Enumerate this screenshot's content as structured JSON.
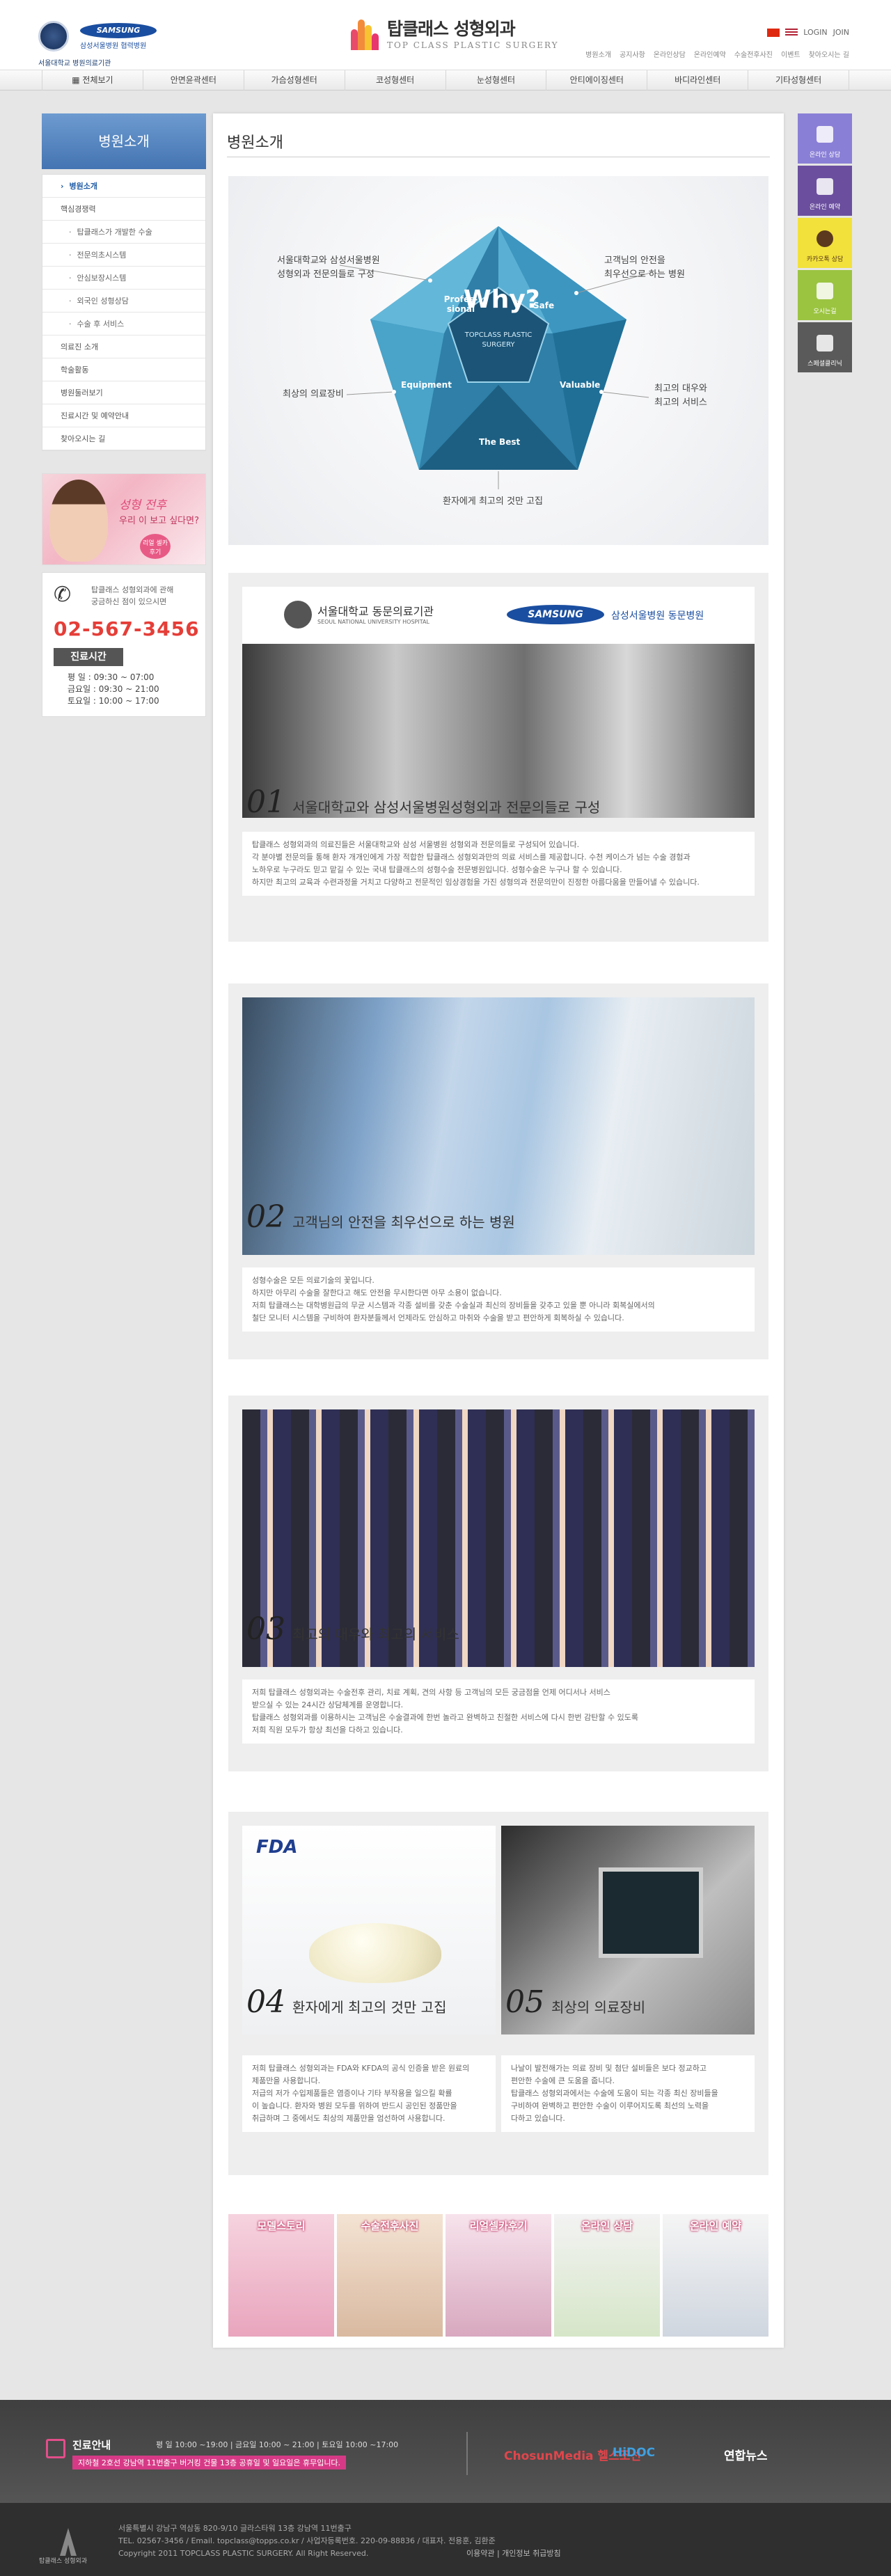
{
  "header": {
    "snu_label": "서울대학교 병원의료기관",
    "samsung_logo": "SAMSUNG",
    "samsung_label": "삼성서울병원 협력병원",
    "brand_title": "탑클래스 성형외과",
    "brand_sub": "TOP CLASS PLASTIC SURGERY",
    "login": "LOGIN",
    "join": "JOIN",
    "util_links": [
      "병원소개",
      "공지사항",
      "온라인상담",
      "온라인예약",
      "수술전후사진",
      "이벤트",
      "찾아오시는 길"
    ]
  },
  "gnb": {
    "items": [
      "전체보기",
      "안면윤곽센터",
      "가슴성형센터",
      "코성형센터",
      "눈성형센터",
      "안티에이징센터",
      "바디라인센터",
      "기타성형센터"
    ]
  },
  "lnb": {
    "title": "병원소개",
    "items": [
      {
        "label": "병원소개",
        "type": "active"
      },
      {
        "label": "핵심경쟁력",
        "type": "main"
      },
      {
        "label": "탑클래스가 개발한 수술",
        "type": "sub"
      },
      {
        "label": "전문의초시스템",
        "type": "sub"
      },
      {
        "label": "안심보장시스템",
        "type": "sub"
      },
      {
        "label": "외국인 성형상담",
        "type": "sub"
      },
      {
        "label": "수술 후 서비스",
        "type": "sub"
      },
      {
        "label": "의료진 소개",
        "type": "main"
      },
      {
        "label": "학술활동",
        "type": "main"
      },
      {
        "label": "병원둘러보기",
        "type": "main"
      },
      {
        "label": "진료시간 및 예약안내",
        "type": "main"
      },
      {
        "label": "찾아오시는 길",
        "type": "main"
      }
    ]
  },
  "promo": {
    "line1": "성형 전후",
    "line2": "우리 이 보고 싶다면?",
    "badge": "리얼 셀카후기"
  },
  "contact": {
    "text1": "탑클래스 성형외과에 관해",
    "text2": "궁금하신 점이 있으시면",
    "phone": "02-567-3456",
    "hours_title": "진료시간",
    "hours": [
      "평   일 : 09:30 ~ 07:00",
      "금요일 : 09:30 ~ 21:00",
      "토요일 : 10:00 ~ 17:00"
    ]
  },
  "quick": {
    "items": [
      {
        "label": "온라인 상담",
        "color": "#8a7fd6"
      },
      {
        "label": "온라인 예약",
        "color": "#6b4f9e"
      },
      {
        "label": "카카오톡 상담",
        "color": "#f2e13a"
      },
      {
        "label": "오시는길",
        "color": "#9bc441"
      },
      {
        "label": "스페셜클리닉",
        "color": "#5a5a5a"
      }
    ]
  },
  "main": {
    "page_title": "병원소개",
    "why": {
      "center": "Why?",
      "center_sub1": "TOPCLASS PLASTIC",
      "center_sub2": "SURGERY",
      "segments": [
        "Profes-sional",
        "Safe",
        "Valuable",
        "The Best",
        "Equipment"
      ],
      "labels": {
        "top_left1": "서울대학교와 삼성서울병원",
        "top_left2": "성형외과 전문의들로 구성",
        "top_right1": "고객님의 안전을",
        "top_right2": "최우선으로 하는 병원",
        "mid_left": "최상의 의료장비",
        "mid_right1": "최고의 대우와",
        "mid_right2": "최고의 서비스",
        "bottom": "환자에게 최고의 것만 고집"
      }
    },
    "section1": {
      "snu": "서울대학교 동문의료기관",
      "snu_sub": "SEOUL NATIONAL UNIVERSITY HOSPITAL",
      "samsung": "SAMSUNG",
      "samsung_label": "삼성서울병원 동문병원",
      "num": "01",
      "title": "서울대학교와 삼성서울병원성형외과 전문의들로 구성",
      "text": [
        "탑클래스 성형외과의 의료진들은 서울대학교와 삼성 서울병원 성형외과 전문의들로 구성되어 있습니다.",
        "각 분야별 전문의들 통해 환자 개개인에게 가장 적합한 탑클래스 성형외과만의 의료 서비스를 제공합니다. 수천 케이스가 넘는 수술 경험과",
        "노하우로 누구라도 믿고 맡길 수 있는 국내 탑클래스의 성형수술 전문병원입니다. 성형수술은 누구나 할 수 있습니다.",
        "하지만 최고의 교육과 수련과정을 거치고 다양하고 전문적인 임상경험을 가진 성형의과 전문의만이 진정한 아름다움을 만들어낼 수 있습니다."
      ]
    },
    "section2": {
      "num": "02",
      "title": "고객님의 안전을 최우선으로 하는 병원",
      "text": [
        "성형수술은 모든 의료기술의 꽃입니다.",
        "하지만 아무리 수술을 잘한다고 해도 안전을 무시한다면 아무 소용이 없습니다.",
        "저희 탑클래스는 대학병원급의 무균 시스템과 각종 설비를 갖춘 수술실과 최신의 장비들을 갖추고 있을 뿐 아니라 회복실에서의",
        "철단 모니터 시스템을 구비하여 환자분들께서 언제라도 안심하고 마취와 수술을 받고 편안하게 회복하실 수 있습니다."
      ]
    },
    "section3": {
      "num": "03",
      "title": "최고의 대우와 최고의 서비스",
      "text": [
        "저희 탑클래스 성형외과는 수술전후 관리, 치료 계획, 견의 사항 등 고객님의 모든 궁금점을 언제 어디서나 서비스",
        "받으실 수 있는 24시간 상담체계를 운영합니다.",
        "탑클래스 성형외과를 이용하시는 고객님은 수술결과에 한번 놀라고 완벽하고 친절한 서비스에 다시 한번 감탄할 수 있도록",
        "저희 직원 모두가 항상 최선을 다하고 있습니다."
      ]
    },
    "section4": {
      "fda": "FDA",
      "num": "04",
      "title": "환자에게 최고의 것만 고집",
      "text": [
        "저희 탑클래스 성형외과는 FDA와 KFDA의 공식 인증을 받은 원료의",
        "제품만을 사용합니다.",
        "저급의 저가 수입제품들은 염증이나 기타 부작용을 일으킬 확률",
        "이 높습니다. 환자와 병원 모두를 위하여 반드시 공인된 정품만을",
        "취급하며 그 중에서도 최상의 제품만을 엄선하여 사용합니다."
      ]
    },
    "section5": {
      "num": "05",
      "title": "최상의 의료장비",
      "text": [
        "나날이 발전해가는 의료 장비 및 첨단 설비들은 보다 정교하고",
        "편안한 수술에 큰 도움을 줍니다.",
        "탑클래스 성형외과에서는 수술에 도움이 되는 각종 최신 장비들을",
        "구비하여 완벽하고 편안한 수술이 이루어지도록 최선의 노력을",
        "다하고 있습니다."
      ]
    },
    "bottom_links": [
      "모델스토리",
      "수술전후사진",
      "리얼셀카후기",
      "온라인 상담",
      "온라인 예약"
    ]
  },
  "footer": {
    "title": "진료안내",
    "hours": "평  일 10:00 ~19:00 | 금요일 10:00 ~ 21:00 | 토요일 10:00 ~17:00",
    "notice": "지하철 2호선 강남역 11번출구 버거킹 건물 13층     공휴일 및 일요일은 휴무입니다.",
    "partners": [
      "ChosunMedia 헬스조선",
      "HiDOC",
      "연합뉴스"
    ],
    "logo_label": "탑클래스 성형외과",
    "address1": "서울특별시 강남구 역삼동 820-9/10 글라스타워 13층 강남역 11번출구",
    "address2": "TEL. 02567-3456 / Email. topclass@topps.co.kr / 사업자등록번호. 220-09-88836 / 대표자. 전용훈, 김환준",
    "copyright": "Copyright  2011  TOPCLASS PLASTIC SURGERY. All Right Reserved.",
    "links": "이용약관  |  개인정보 취급방침"
  }
}
